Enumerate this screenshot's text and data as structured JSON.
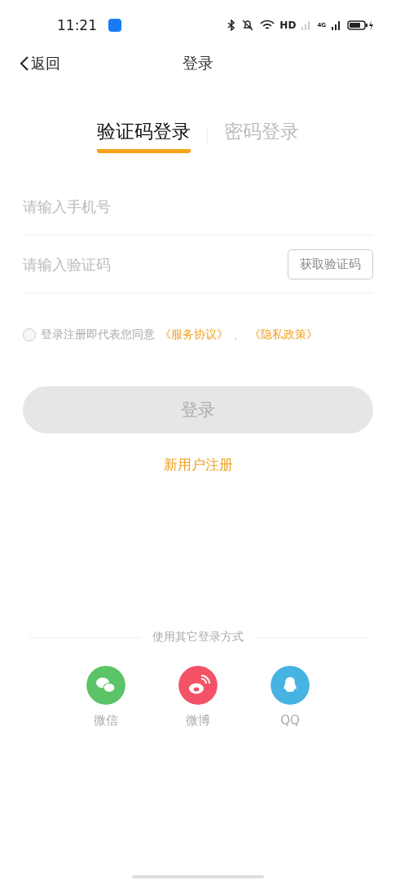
{
  "status_bar": {
    "time": "11:21",
    "hd": "HD",
    "network": "4G"
  },
  "nav": {
    "back": "返回",
    "title": "登录"
  },
  "tabs": [
    {
      "label": "验证码登录",
      "selected": true
    },
    {
      "label": "密码登录",
      "selected": false
    }
  ],
  "phone_field": {
    "placeholder": "请输入手机号"
  },
  "code_field": {
    "placeholder": "请输入验证码",
    "button": "获取验证码"
  },
  "agreement": {
    "checked": false,
    "text": "登录注册即代表您同意",
    "links": [
      "《服务协议》",
      "《隐私政策》"
    ],
    "separator": "、"
  },
  "login_button": {
    "label": "登录",
    "disabled": true
  },
  "register_link": "新用户注册",
  "other_login": {
    "title": "使用其它登录方式",
    "options": [
      {
        "kind": "wechat",
        "label": "微信",
        "color": "#5ac466"
      },
      {
        "kind": "weibo",
        "label": "微博",
        "color": "#f45267"
      },
      {
        "kind": "qq",
        "label": "QQ",
        "color": "#47b3e3"
      }
    ]
  }
}
